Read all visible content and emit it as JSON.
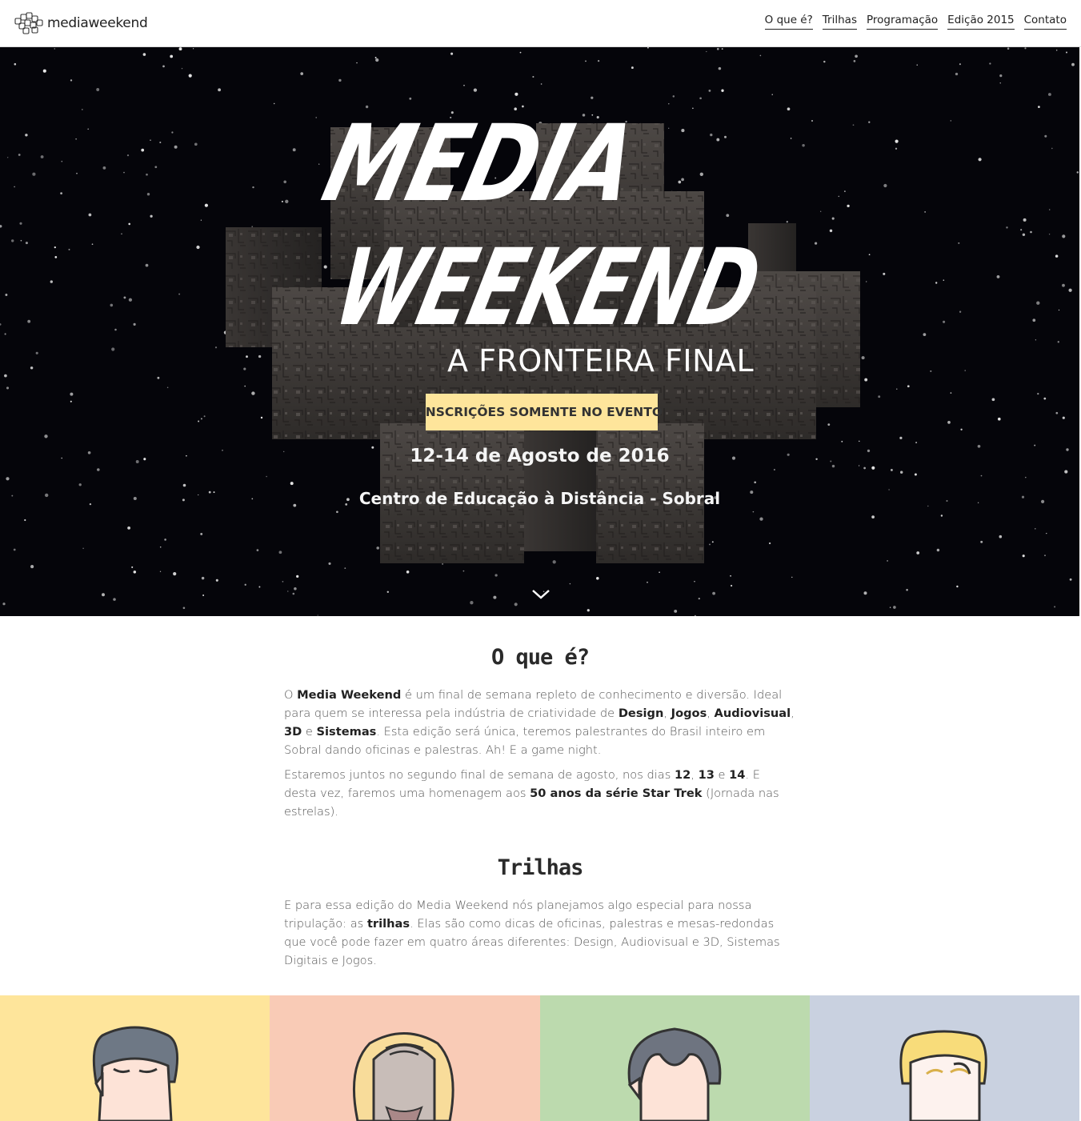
{
  "header": {
    "logo_text": "mediaweekend",
    "nav": [
      "O que é?",
      "Trilhas",
      "Programação",
      "Edição 2015",
      "Contato"
    ]
  },
  "hero": {
    "title_line1": "MEDIA",
    "title_line2": "WEEKEND",
    "subtitle": "A FRONTEIRA FINAL",
    "cta": "INSCRIÇÕES SOMENTE NO EVENTO",
    "dates": "12-14 de Agosto de 2016",
    "place": "Centro de Educação à Distância - Sobral"
  },
  "about": {
    "title": "O que é?",
    "p1": {
      "t1": "O ",
      "b1": "Media Weekend",
      "t2": " é um final de semana repleto de conhecimento e diversão. Ideal para quem se interessa pela indústria de criatividade de ",
      "b2": "Design",
      "t3": ", ",
      "b3": "Jogos",
      "t4": ", ",
      "b4": "Audiovisual",
      "t5": ", ",
      "b5": "3D",
      "t6": " e ",
      "b6": "Sistemas",
      "t7": ". Esta edição será única, teremos palestrantes do Brasil inteiro em Sobral dando oficinas e palestras. Ah! E a game night."
    },
    "p2": {
      "t1": "Estaremos juntos no segundo final de semana de agosto, nos dias ",
      "b1": "12",
      "t2": ", ",
      "b2": "13",
      "t3": " e ",
      "b3": "14",
      "t4": ". E desta vez, faremos uma homenagem aos ",
      "b4": "50 anos da série Star Trek",
      "t5": " (Jornada nas estrelas)."
    }
  },
  "trilhas": {
    "title": "Trilhas",
    "p1": {
      "t1": "E para essa edição do Media Weekend nós planejamos algo especial para nossa tripulação: as ",
      "b1": "trilhas",
      "t2": ". Elas são como dicas de oficinas, palestras e mesas-redondas que você pode fazer em quatro áreas diferentes: Design, Audiovisual e 3D, Sistemas Digitais e Jogos."
    }
  },
  "tracks": [
    {
      "icon": "spock-face-icon",
      "color": "#fee59b"
    },
    {
      "icon": "klingon-face-icon",
      "color": "#f9cbb6"
    },
    {
      "icon": "vulcan-face-icon",
      "color": "#bcdaae"
    },
    {
      "icon": "data-face-icon",
      "color": "#c9d1e0"
    }
  ]
}
